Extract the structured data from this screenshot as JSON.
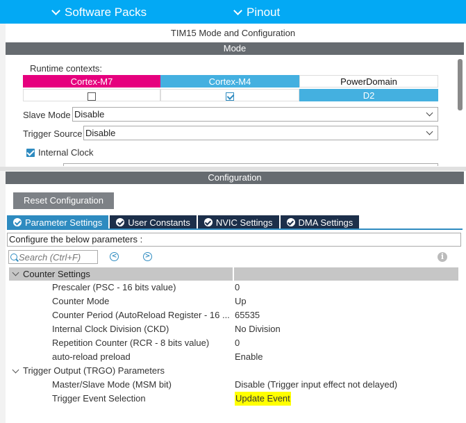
{
  "topbar": {
    "software_packs": "Software Packs",
    "pinout": "Pinout"
  },
  "mode_panel": {
    "title": "TIM15 Mode and Configuration",
    "section_label": "Mode",
    "runtime_label": "Runtime contexts:",
    "contexts": [
      {
        "name": "Cortex-M7",
        "color": "#e6007e",
        "checked": false
      },
      {
        "name": "Cortex-M4",
        "color": "#44b0e0",
        "checked": true
      },
      {
        "name": "PowerDomain",
        "value": "D2",
        "color": "#44b0e0"
      }
    ],
    "slave_mode": {
      "label": "Slave Mode",
      "value": "Disable"
    },
    "trigger_source": {
      "label": "Trigger Source",
      "value": "Disable"
    },
    "internal_clock": {
      "label": "Internal Clock",
      "checked": true
    }
  },
  "config_panel": {
    "section_label": "Configuration",
    "reset_button": "Reset Configuration",
    "tabs": [
      {
        "label": "Parameter Settings",
        "active": true
      },
      {
        "label": "User Constants",
        "active": false
      },
      {
        "label": "NVIC Settings",
        "active": false
      },
      {
        "label": "DMA Settings",
        "active": false
      }
    ],
    "hint": "Configure the below parameters :",
    "search_placeholder": "Search (Ctrl+F)",
    "groups": [
      {
        "name": "Counter Settings",
        "params": [
          {
            "name": "Prescaler (PSC - 16 bits value)",
            "value": "0"
          },
          {
            "name": "Counter Mode",
            "value": "Up"
          },
          {
            "name": "Counter Period (AutoReload Register - 16 ...",
            "value": "65535"
          },
          {
            "name": "Internal Clock Division (CKD)",
            "value": "No Division"
          },
          {
            "name": "Repetition Counter (RCR - 8 bits value)",
            "value": "0"
          },
          {
            "name": "auto-reload preload",
            "value": "Enable"
          }
        ]
      },
      {
        "name": "Trigger Output (TRGO) Parameters",
        "params": [
          {
            "name": "Master/Slave Mode (MSM bit)",
            "value": "Disable (Trigger input effect not delayed)"
          },
          {
            "name": "Trigger Event Selection",
            "value": "Update Event",
            "highlighted": true
          }
        ]
      }
    ]
  },
  "colors": {
    "topbar": "#03a9f4",
    "section_bar": "#666b70",
    "tab_active": "#2e8bc0",
    "tab_inactive": "#1c2f4a",
    "highlight": "#ffff00"
  }
}
